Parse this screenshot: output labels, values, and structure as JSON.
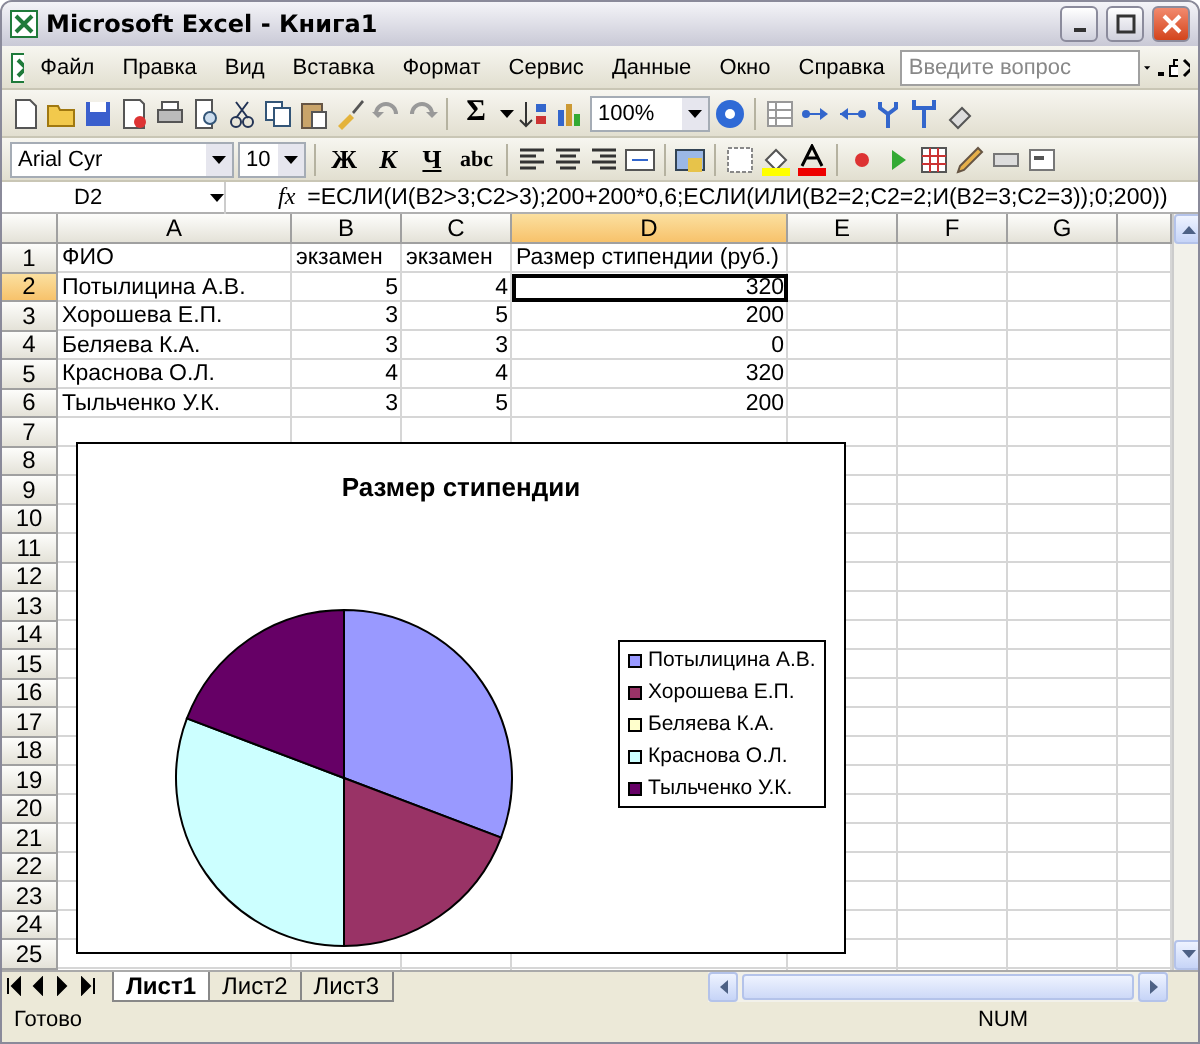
{
  "window": {
    "title": "Microsoft Excel - Книга1"
  },
  "menu": [
    "Файл",
    "Правка",
    "Вид",
    "Вставка",
    "Формат",
    "Сервис",
    "Данные",
    "Окно",
    "Справка"
  ],
  "help_box": {
    "placeholder": "Введите вопрос"
  },
  "standard_toolbar": {
    "sum": "Σ",
    "zoom": "100%"
  },
  "formatting_toolbar": {
    "font": "Arial Cyr",
    "size": "10",
    "styles": [
      "Ж",
      "К",
      "Ч",
      "abc"
    ]
  },
  "formula_bar": {
    "name_box": "D2",
    "fx": "fx",
    "formula": "=ЕСЛИ(И(B2>3;C2>3);200+200*0,6;ЕСЛИ(ИЛИ(B2=2;C2=2;И(B2=3;C2=3));0;200))"
  },
  "columns": [
    {
      "label": "A",
      "selected": false
    },
    {
      "label": "B",
      "selected": false
    },
    {
      "label": "C",
      "selected": false
    },
    {
      "label": "D",
      "selected": true
    },
    {
      "label": "E",
      "selected": false
    },
    {
      "label": "F",
      "selected": false
    },
    {
      "label": "G",
      "selected": false
    }
  ],
  "rows": [
    {
      "number": "1",
      "selected": false,
      "cells": [
        {
          "text": "ФИО",
          "active": false
        },
        {
          "text": "экзамен",
          "active": false
        },
        {
          "text": "экзамен",
          "active": false
        },
        {
          "text": "Размер стипендии (руб.)",
          "active": false
        }
      ]
    },
    {
      "number": "2",
      "selected": true,
      "cells": [
        {
          "text": "Потылицина А.В.",
          "active": false
        },
        {
          "text": "5",
          "active": false
        },
        {
          "text": "4",
          "active": false
        },
        {
          "text": "320",
          "active": true
        }
      ]
    },
    {
      "number": "3",
      "selected": false,
      "cells": [
        {
          "text": "Хорошева Е.П.",
          "active": false
        },
        {
          "text": "3",
          "active": false
        },
        {
          "text": "5",
          "active": false
        },
        {
          "text": "200",
          "active": false
        }
      ]
    },
    {
      "number": "4",
      "selected": false,
      "cells": [
        {
          "text": "Беляева К.А.",
          "active": false
        },
        {
          "text": "3",
          "active": false
        },
        {
          "text": "3",
          "active": false
        },
        {
          "text": "0",
          "active": false
        }
      ]
    },
    {
      "number": "5",
      "selected": false,
      "cells": [
        {
          "text": "Краснова О.Л.",
          "active": false
        },
        {
          "text": "4",
          "active": false
        },
        {
          "text": "4",
          "active": false
        },
        {
          "text": "320",
          "active": false
        }
      ]
    },
    {
      "number": "6",
      "selected": false,
      "cells": [
        {
          "text": "Тыльченко У.К.",
          "active": false
        },
        {
          "text": "3",
          "active": false
        },
        {
          "text": "5",
          "active": false
        },
        {
          "text": "200",
          "active": false
        }
      ]
    },
    {
      "number": "7",
      "selected": false
    },
    {
      "number": "8",
      "selected": false
    },
    {
      "number": "9",
      "selected": false
    },
    {
      "number": "10",
      "selected": false
    },
    {
      "number": "11",
      "selected": false
    },
    {
      "number": "12",
      "selected": false
    },
    {
      "number": "13",
      "selected": false
    },
    {
      "number": "14",
      "selected": false
    },
    {
      "number": "15",
      "selected": false
    },
    {
      "number": "16",
      "selected": false
    },
    {
      "number": "17",
      "selected": false
    },
    {
      "number": "18",
      "selected": false
    },
    {
      "number": "19",
      "selected": false
    },
    {
      "number": "20",
      "selected": false
    },
    {
      "number": "21",
      "selected": false
    },
    {
      "number": "22",
      "selected": false
    },
    {
      "number": "23",
      "selected": false
    },
    {
      "number": "24",
      "selected": false
    },
    {
      "number": "25",
      "selected": false
    }
  ],
  "chart": {
    "chart_data": {
      "type": "pie",
      "title": "Размер стипендии",
      "categories": [
        "Потылицина А.В.",
        "Хорошева Е.П.",
        "Беляева К.А.",
        "Краснова О.Л.",
        "Тыльченко У.К."
      ],
      "series": [
        {
          "values": [
            30.77,
            19.23,
            0,
            30.77,
            19.23
          ]
        }
      ],
      "colors": [
        "#9999ff",
        "#993366",
        "#ffffcc",
        "#ccffff",
        "#660066"
      ]
    }
  },
  "sheet_tabs": [
    {
      "label": "Лист1",
      "selected": true
    },
    {
      "label": "Лист2",
      "selected": false
    },
    {
      "label": "Лист3",
      "selected": false
    }
  ],
  "status_bar": {
    "message": "Готово",
    "num": "NUM"
  }
}
